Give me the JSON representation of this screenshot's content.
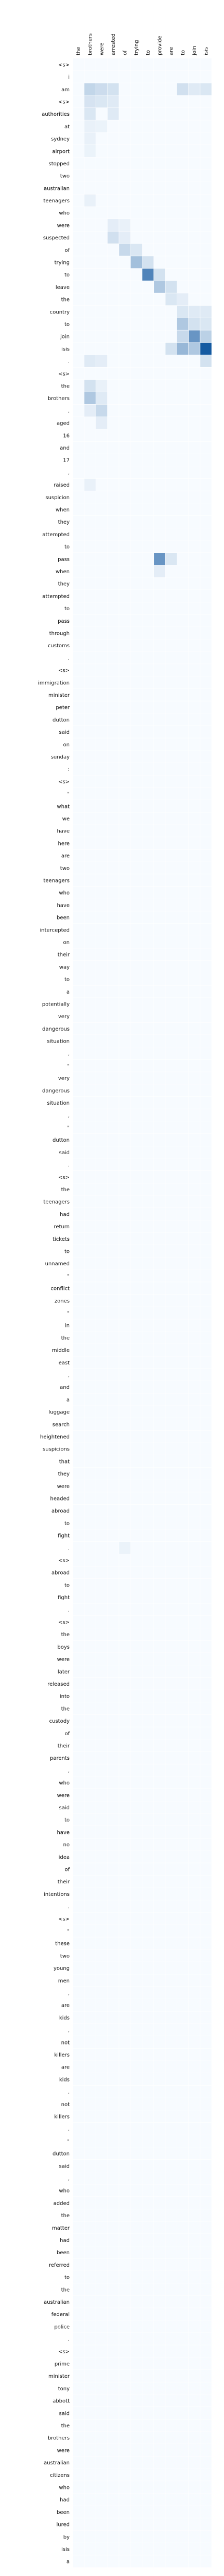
{
  "chart_data": {
    "type": "heatmap",
    "x_labels": [
      "the",
      "brothers",
      "were",
      "arrested",
      "of",
      "trying",
      "to",
      "provide",
      "are",
      "to",
      "join",
      "isis"
    ],
    "y_labels": [
      "<s>",
      "i",
      "am",
      "<s>",
      "authorities",
      "at",
      "sydney",
      "airport",
      "stopped",
      "two",
      "australian",
      "teenagers",
      "who",
      "were",
      "suspected",
      "of",
      "trying",
      "to",
      "leave",
      "the",
      "country",
      "to",
      "join",
      "isis",
      ".",
      "<s>",
      "the",
      "brothers",
      ",",
      "aged",
      "16",
      "and",
      "17",
      ",",
      "raised",
      "suspicion",
      "when",
      "they",
      "attempted",
      "to",
      "pass",
      "when",
      "they",
      "attempted",
      "to",
      "pass",
      "through",
      "customs",
      ".",
      "<s>",
      "immigration",
      "minister",
      "peter",
      "dutton",
      "said",
      "on",
      "sunday",
      ":",
      "<s>",
      "\"",
      "what",
      "we",
      "have",
      "here",
      "are",
      "two",
      "teenagers",
      "who",
      "have",
      "been",
      "intercepted",
      "on",
      "their",
      "way",
      "to",
      "a",
      "potentially",
      "very",
      "dangerous",
      "situation",
      ",",
      "\"",
      "very",
      "dangerous",
      "situation",
      ",",
      "\"",
      "dutton",
      "said",
      ".",
      "<s>",
      "the",
      "teenagers",
      "had",
      "return",
      "tickets",
      "to",
      "unnamed",
      "\"",
      "conflict",
      "zones",
      "\"",
      "in",
      "the",
      "middle",
      "east",
      ",",
      "and",
      "a",
      "luggage",
      "search",
      "heightened",
      "suspicions",
      "that",
      "they",
      "were",
      "headed",
      "abroad",
      "to",
      "fight",
      ".",
      "<s>",
      "abroad",
      "to",
      "fight",
      ".",
      "<s>",
      "the",
      "boys",
      "were",
      "later",
      "released",
      "into",
      "the",
      "custody",
      "of",
      "their",
      "parents",
      ",",
      "who",
      "were",
      "said",
      "to",
      "have",
      "no",
      "idea",
      "of",
      "their",
      "intentions",
      ".",
      "<s>",
      "\"",
      "these",
      "two",
      "young",
      "men",
      ",",
      "are",
      "kids",
      ",",
      "not",
      "killers",
      "are",
      "kids",
      ",",
      "not",
      "killers",
      ",",
      "\"",
      "dutton",
      "said",
      ",",
      "who",
      "added",
      "the",
      "matter",
      "had",
      "been",
      "referred",
      "to",
      "the",
      "australian",
      "federal",
      "police",
      ".",
      "<s>",
      "prime",
      "minister",
      "tony",
      "abbott",
      "said",
      "the",
      "brothers",
      "were",
      "australian",
      "citizens",
      "who",
      "had",
      "been",
      "lured",
      "by",
      "isis",
      "a"
    ],
    "color_scale": [
      "#f7fbff",
      "#08519c"
    ],
    "highlights": [
      {
        "row": 2,
        "col": 1,
        "value": 0.22
      },
      {
        "row": 2,
        "col": 2,
        "value": 0.18
      },
      {
        "row": 2,
        "col": 3,
        "value": 0.15
      },
      {
        "row": 2,
        "col": 9,
        "value": 0.16
      },
      {
        "row": 2,
        "col": 10,
        "value": 0.1
      },
      {
        "row": 2,
        "col": 11,
        "value": 0.12
      },
      {
        "row": 3,
        "col": 1,
        "value": 0.14
      },
      {
        "row": 3,
        "col": 2,
        "value": 0.12
      },
      {
        "row": 3,
        "col": 3,
        "value": 0.1
      },
      {
        "row": 4,
        "col": 1,
        "value": 0.12
      },
      {
        "row": 4,
        "col": 3,
        "value": 0.1
      },
      {
        "row": 5,
        "col": 1,
        "value": 0.06
      },
      {
        "row": 5,
        "col": 2,
        "value": 0.05
      },
      {
        "row": 6,
        "col": 1,
        "value": 0.06
      },
      {
        "row": 7,
        "col": 1,
        "value": 0.05
      },
      {
        "row": 11,
        "col": 1,
        "value": 0.06
      },
      {
        "row": 13,
        "col": 3,
        "value": 0.08
      },
      {
        "row": 13,
        "col": 4,
        "value": 0.06
      },
      {
        "row": 14,
        "col": 3,
        "value": 0.16
      },
      {
        "row": 14,
        "col": 4,
        "value": 0.08
      },
      {
        "row": 15,
        "col": 4,
        "value": 0.2
      },
      {
        "row": 15,
        "col": 5,
        "value": 0.12
      },
      {
        "row": 16,
        "col": 5,
        "value": 0.35
      },
      {
        "row": 16,
        "col": 6,
        "value": 0.15
      },
      {
        "row": 17,
        "col": 6,
        "value": 0.7
      },
      {
        "row": 17,
        "col": 7,
        "value": 0.15
      },
      {
        "row": 18,
        "col": 7,
        "value": 0.3
      },
      {
        "row": 18,
        "col": 8,
        "value": 0.15
      },
      {
        "row": 19,
        "col": 8,
        "value": 0.12
      },
      {
        "row": 19,
        "col": 9,
        "value": 0.08
      },
      {
        "row": 20,
        "col": 9,
        "value": 0.12
      },
      {
        "row": 20,
        "col": 10,
        "value": 0.1
      },
      {
        "row": 20,
        "col": 11,
        "value": 0.1
      },
      {
        "row": 21,
        "col": 9,
        "value": 0.3
      },
      {
        "row": 21,
        "col": 10,
        "value": 0.15
      },
      {
        "row": 21,
        "col": 11,
        "value": 0.12
      },
      {
        "row": 22,
        "col": 9,
        "value": 0.2
      },
      {
        "row": 22,
        "col": 10,
        "value": 0.6
      },
      {
        "row": 22,
        "col": 11,
        "value": 0.25
      },
      {
        "row": 23,
        "col": 8,
        "value": 0.15
      },
      {
        "row": 23,
        "col": 9,
        "value": 0.4
      },
      {
        "row": 23,
        "col": 10,
        "value": 0.3
      },
      {
        "row": 23,
        "col": 11,
        "value": 0.95
      },
      {
        "row": 24,
        "col": 1,
        "value": 0.1
      },
      {
        "row": 24,
        "col": 2,
        "value": 0.08
      },
      {
        "row": 24,
        "col": 11,
        "value": 0.15
      },
      {
        "row": 26,
        "col": 1,
        "value": 0.15
      },
      {
        "row": 26,
        "col": 2,
        "value": 0.06
      },
      {
        "row": 27,
        "col": 1,
        "value": 0.3
      },
      {
        "row": 27,
        "col": 2,
        "value": 0.1
      },
      {
        "row": 28,
        "col": 1,
        "value": 0.08
      },
      {
        "row": 28,
        "col": 2,
        "value": 0.2
      },
      {
        "row": 29,
        "col": 2,
        "value": 0.08
      },
      {
        "row": 34,
        "col": 1,
        "value": 0.06
      },
      {
        "row": 40,
        "col": 7,
        "value": 0.6
      },
      {
        "row": 40,
        "col": 8,
        "value": 0.12
      },
      {
        "row": 41,
        "col": 7,
        "value": 0.08
      },
      {
        "row": 120,
        "col": 4,
        "value": 0.05
      },
      {
        "row": 221,
        "col": 4,
        "value": 0.05
      }
    ]
  }
}
